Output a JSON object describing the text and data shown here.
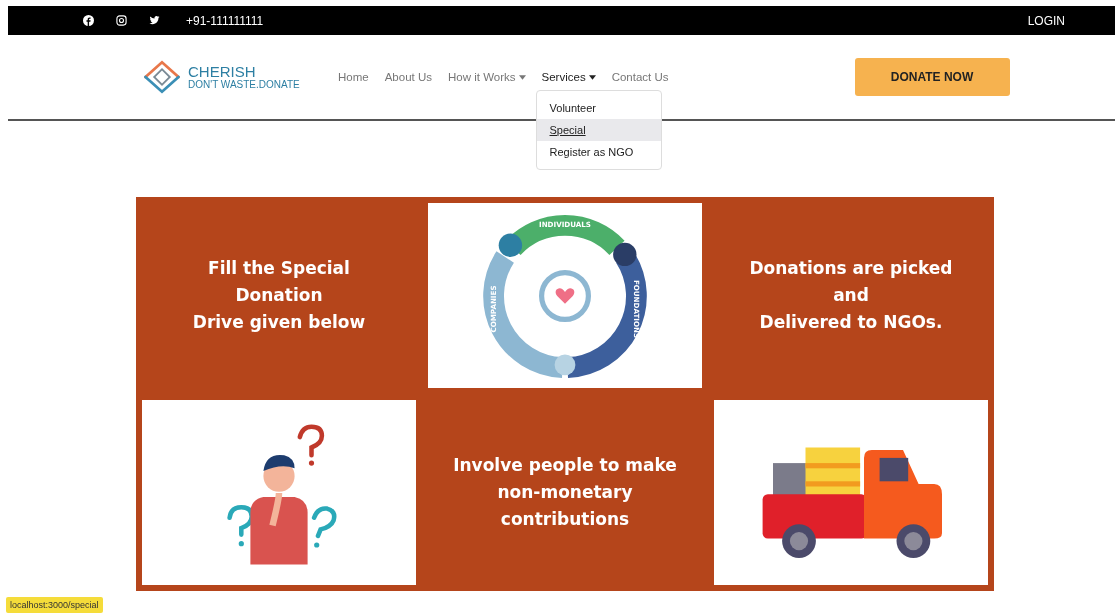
{
  "top_bar": {
    "phone": "+91-111111111",
    "login": "LOGIN"
  },
  "brand": {
    "name": "CHERISH",
    "tagline": "DON'T WASTE.DONATE"
  },
  "nav": [
    {
      "label": "Home",
      "kind": "link",
      "selected": false
    },
    {
      "label": "About Us",
      "kind": "link",
      "selected": false
    },
    {
      "label": "How it Works",
      "kind": "dropdown",
      "selected": false
    },
    {
      "label": "Services",
      "kind": "dropdown",
      "selected": true
    },
    {
      "label": "Contact Us",
      "kind": "link",
      "selected": false
    }
  ],
  "dropdown": [
    {
      "label": "Volunteer",
      "selected": false
    },
    {
      "label": "Special",
      "selected": true
    },
    {
      "label": "Register as NGO",
      "selected": false
    }
  ],
  "donate_button": "DONATE NOW",
  "tiles": [
    {
      "kind": "text",
      "text": "Fill the Special\nDonation\nDrive given below"
    },
    {
      "kind": "cycle",
      "labels": [
        "INDIVIDUALS",
        "FOUNDATIONS",
        "COMPANIES"
      ]
    },
    {
      "kind": "text",
      "text": "Donations are picked\nand\nDelivered to NGOs."
    },
    {
      "kind": "person"
    },
    {
      "kind": "text",
      "text": "Involve people to make\nnon-monetary\ncontributions"
    },
    {
      "kind": "truck"
    }
  ],
  "status_url": "localhost:3000/special"
}
